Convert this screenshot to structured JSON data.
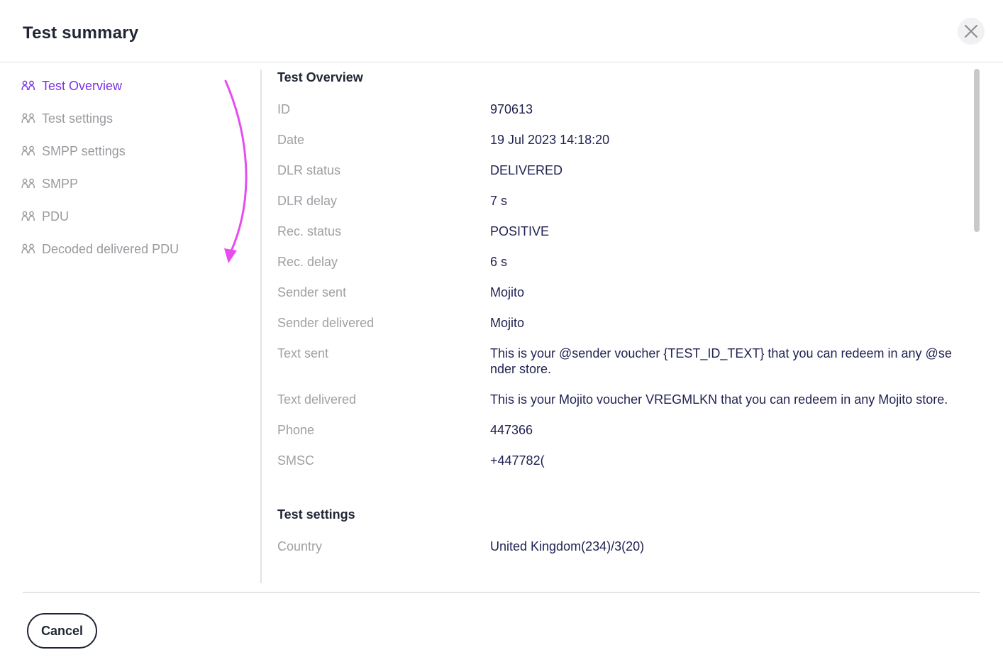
{
  "dialog": {
    "title": "Test summary",
    "close_icon": "close-icon",
    "cancel_label": "Cancel"
  },
  "sidebar": {
    "items": [
      {
        "label": "Test Overview",
        "active": true,
        "icon": "users-icon"
      },
      {
        "label": "Test settings",
        "active": false,
        "icon": "users-icon"
      },
      {
        "label": "SMPP settings",
        "active": false,
        "icon": "users-icon"
      },
      {
        "label": "SMPP",
        "active": false,
        "icon": "users-icon"
      },
      {
        "label": "PDU",
        "active": false,
        "icon": "users-icon"
      },
      {
        "label": "Decoded delivered PDU",
        "active": false,
        "icon": "users-icon"
      }
    ]
  },
  "overview": {
    "title": "Test Overview",
    "rows": [
      {
        "label": "ID",
        "value": "970613"
      },
      {
        "label": "Date",
        "value": "19 Jul 2023 14:18:20"
      },
      {
        "label": "DLR status",
        "value": "DELIVERED"
      },
      {
        "label": "DLR delay",
        "value": "7 s"
      },
      {
        "label": "Rec. status",
        "value": "POSITIVE"
      },
      {
        "label": "Rec. delay",
        "value": "6 s"
      },
      {
        "label": "Sender sent",
        "value": "Mojito"
      },
      {
        "label": "Sender delivered",
        "value": "Mojito"
      },
      {
        "label": "Text sent",
        "value": "This is your @sender voucher {TEST_ID_TEXT} that you can redeem in any @sender store."
      },
      {
        "label": "Text delivered",
        "value": "This is your Mojito voucher VREGMLKN that you can redeem in any Mojito store."
      },
      {
        "label": "Phone",
        "value": "447366"
      },
      {
        "label": "SMSC",
        "value": "+447782("
      }
    ]
  },
  "settings": {
    "title": "Test settings",
    "rows": [
      {
        "label": "Country",
        "value": "United Kingdom(234)/3(20)"
      }
    ]
  },
  "colors": {
    "accent": "#7a33e6",
    "annotation_arrow": "#e84cf0",
    "label": "#a0a0a5",
    "value": "#1f2150"
  }
}
